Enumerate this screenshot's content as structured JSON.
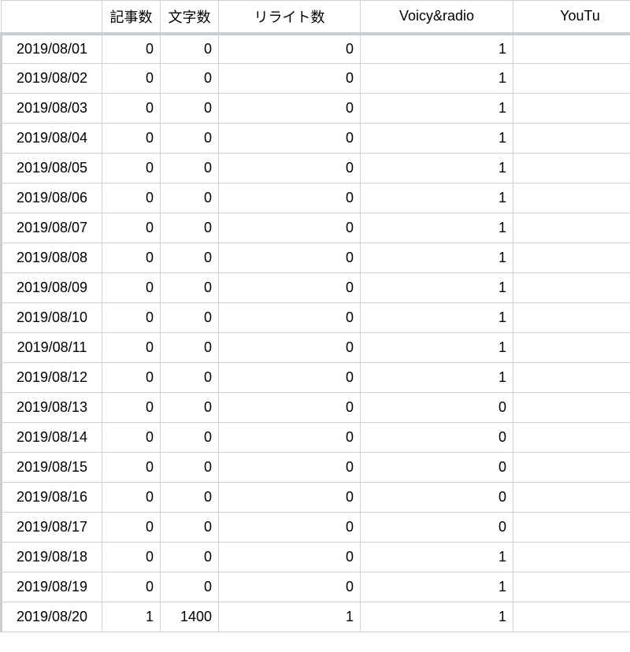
{
  "chart_data": {
    "type": "table",
    "headers": [
      "",
      "記事数",
      "文字数",
      "リライト数",
      "Voicy&radio",
      "YouTu"
    ],
    "rows": [
      {
        "date": "2019/08/01",
        "articles": 0,
        "chars": 0,
        "rewrites": 0,
        "voicy": 1
      },
      {
        "date": "2019/08/02",
        "articles": 0,
        "chars": 0,
        "rewrites": 0,
        "voicy": 1
      },
      {
        "date": "2019/08/03",
        "articles": 0,
        "chars": 0,
        "rewrites": 0,
        "voicy": 1
      },
      {
        "date": "2019/08/04",
        "articles": 0,
        "chars": 0,
        "rewrites": 0,
        "voicy": 1
      },
      {
        "date": "2019/08/05",
        "articles": 0,
        "chars": 0,
        "rewrites": 0,
        "voicy": 1
      },
      {
        "date": "2019/08/06",
        "articles": 0,
        "chars": 0,
        "rewrites": 0,
        "voicy": 1
      },
      {
        "date": "2019/08/07",
        "articles": 0,
        "chars": 0,
        "rewrites": 0,
        "voicy": 1
      },
      {
        "date": "2019/08/08",
        "articles": 0,
        "chars": 0,
        "rewrites": 0,
        "voicy": 1
      },
      {
        "date": "2019/08/09",
        "articles": 0,
        "chars": 0,
        "rewrites": 0,
        "voicy": 1
      },
      {
        "date": "2019/08/10",
        "articles": 0,
        "chars": 0,
        "rewrites": 0,
        "voicy": 1
      },
      {
        "date": "2019/08/11",
        "articles": 0,
        "chars": 0,
        "rewrites": 0,
        "voicy": 1
      },
      {
        "date": "2019/08/12",
        "articles": 0,
        "chars": 0,
        "rewrites": 0,
        "voicy": 1
      },
      {
        "date": "2019/08/13",
        "articles": 0,
        "chars": 0,
        "rewrites": 0,
        "voicy": 0
      },
      {
        "date": "2019/08/14",
        "articles": 0,
        "chars": 0,
        "rewrites": 0,
        "voicy": 0
      },
      {
        "date": "2019/08/15",
        "articles": 0,
        "chars": 0,
        "rewrites": 0,
        "voicy": 0
      },
      {
        "date": "2019/08/16",
        "articles": 0,
        "chars": 0,
        "rewrites": 0,
        "voicy": 0
      },
      {
        "date": "2019/08/17",
        "articles": 0,
        "chars": 0,
        "rewrites": 0,
        "voicy": 0
      },
      {
        "date": "2019/08/18",
        "articles": 0,
        "chars": 0,
        "rewrites": 0,
        "voicy": 1
      },
      {
        "date": "2019/08/19",
        "articles": 0,
        "chars": 0,
        "rewrites": 0,
        "voicy": 1
      },
      {
        "date": "2019/08/20",
        "articles": 1,
        "chars": 1400,
        "rewrites": 1,
        "voicy": 1
      }
    ]
  }
}
